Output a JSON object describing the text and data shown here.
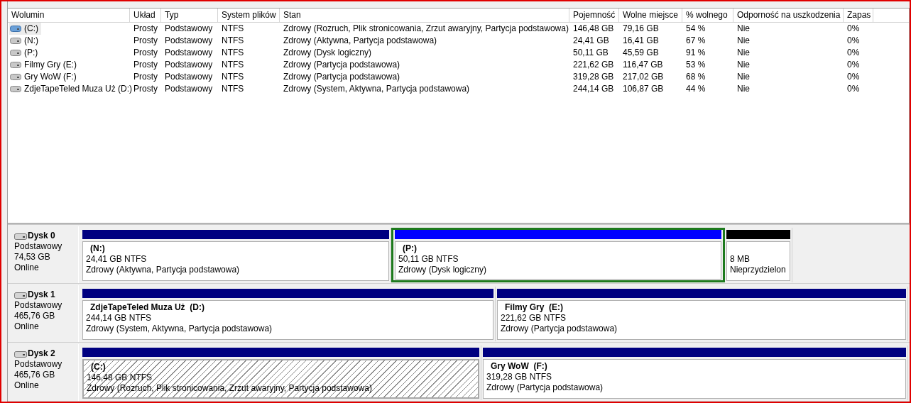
{
  "volume_list": {
    "columns": [
      "Wolumin",
      "Układ",
      "Typ",
      "System plików",
      "Stan",
      "Pojemność",
      "Wolne miejsce",
      "% wolnego",
      "Odporność na uszkodzenia",
      "Zapas"
    ],
    "rows": [
      {
        "selected": true,
        "cells": [
          "(C:)",
          "Prosty",
          "Podstawowy",
          "NTFS",
          "Zdrowy (Rozruch, Plik stronicowania, Zrzut awaryjny, Partycja podstawowa)",
          "146,48 GB",
          "79,16 GB",
          "54 %",
          "Nie",
          "0%"
        ]
      },
      {
        "selected": false,
        "cells": [
          "(N:)",
          "Prosty",
          "Podstawowy",
          "NTFS",
          "Zdrowy (Aktywna, Partycja podstawowa)",
          "24,41 GB",
          "16,41 GB",
          "67 %",
          "Nie",
          "0%"
        ]
      },
      {
        "selected": false,
        "cells": [
          "(P:)",
          "Prosty",
          "Podstawowy",
          "NTFS",
          "Zdrowy (Dysk logiczny)",
          "50,11 GB",
          "45,59 GB",
          "91 %",
          "Nie",
          "0%"
        ]
      },
      {
        "selected": false,
        "cells": [
          "Filmy Gry (E:)",
          "Prosty",
          "Podstawowy",
          "NTFS",
          "Zdrowy (Partycja podstawowa)",
          "221,62 GB",
          "116,47 GB",
          "53 %",
          "Nie",
          "0%"
        ]
      },
      {
        "selected": false,
        "cells": [
          "Gry WoW (F:)",
          "Prosty",
          "Podstawowy",
          "NTFS",
          "Zdrowy (Partycja podstawowa)",
          "319,28 GB",
          "217,02 GB",
          "68 %",
          "Nie",
          "0%"
        ]
      },
      {
        "selected": false,
        "cells": [
          "ZdjeTapeTeled Muza Uż (D:)",
          "Prosty",
          "Podstawowy",
          "NTFS",
          "Zdrowy (System, Aktywna, Partycja podstawowa)",
          "244,14 GB",
          "106,87 GB",
          "44 %",
          "Nie",
          "0%"
        ]
      }
    ]
  },
  "disks": [
    {
      "name": "Dysk 0",
      "type": "Podstawowy",
      "size": "74,53 GB",
      "status": "Online",
      "partitions": [
        {
          "kind": "primary",
          "selected": false,
          "name": "(N:)",
          "size": "24,41 GB NTFS",
          "status": "Zdrowy (Aktywna, Partycja podstawowa)"
        },
        {
          "kind": "logical",
          "selected": false,
          "name": "(P:)",
          "size": "50,11 GB NTFS",
          "status": "Zdrowy (Dysk logiczny)"
        },
        {
          "kind": "unallocated",
          "selected": false,
          "size": "8 MB",
          "status": "Nieprzydzielon"
        }
      ]
    },
    {
      "name": "Dysk 1",
      "type": "Podstawowy",
      "size": "465,76 GB",
      "status": "Online",
      "partitions": [
        {
          "kind": "primary",
          "selected": false,
          "name": "ZdjeTapeTeled Muza Uż  (D:)",
          "size": "244,14 GB NTFS",
          "status": "Zdrowy (System, Aktywna, Partycja podstawowa)"
        },
        {
          "kind": "primary",
          "selected": false,
          "name": "Filmy Gry  (E:)",
          "size": "221,62 GB NTFS",
          "status": "Zdrowy (Partycja podstawowa)"
        }
      ]
    },
    {
      "name": "Dysk 2",
      "type": "Podstawowy",
      "size": "465,76 GB",
      "status": "Online",
      "partitions": [
        {
          "kind": "primary",
          "selected": true,
          "name": "(C:)",
          "size": "146,48 GB NTFS",
          "status": "Zdrowy (Rozruch, Plik stronicowania, Zrzut awaryjny, Partycja podstawowa)"
        },
        {
          "kind": "primary",
          "selected": false,
          "name": "Gry WoW  (F:)",
          "size": "319,28 GB NTFS",
          "status": "Zdrowy (Partycja podstawowa)"
        }
      ]
    }
  ]
}
